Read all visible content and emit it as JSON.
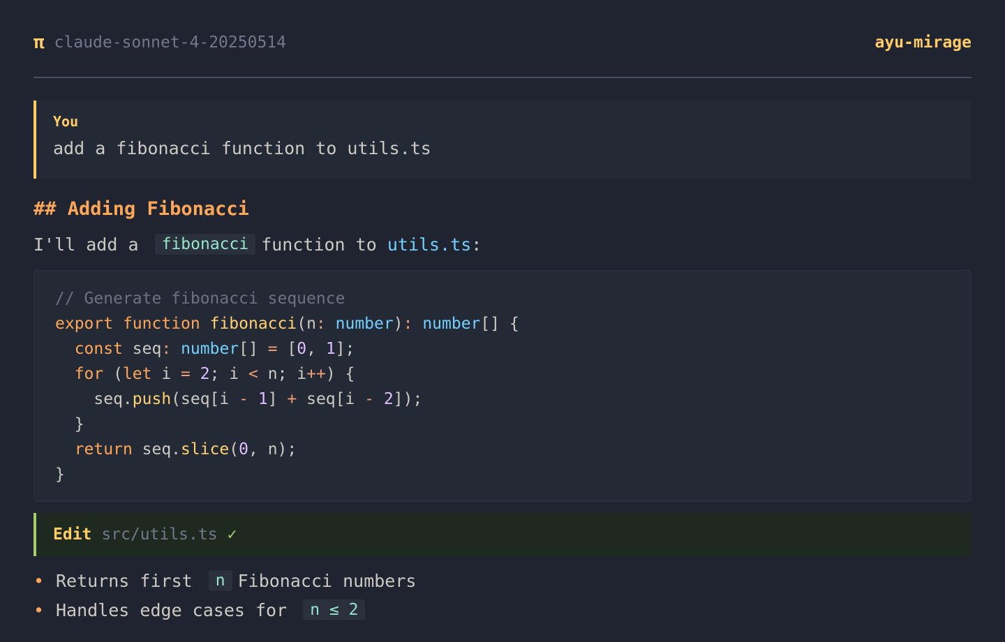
{
  "header": {
    "logo_glyph": "π",
    "model": "claude-sonnet-4-20250514",
    "theme": "ayu-mirage"
  },
  "user_message": {
    "label": "You",
    "text": "add a fibonacci function to utils.ts"
  },
  "response": {
    "heading": "## Adding Fibonacci",
    "intro": {
      "before": "I'll add a",
      "code": "fibonacci",
      "middle": "function to",
      "link": "utils.ts",
      "after": ":"
    },
    "code_lines": [
      [
        {
          "t": "// Generate fibonacci sequence",
          "c": "comment"
        }
      ],
      [
        {
          "t": "export",
          "c": "kw"
        },
        {
          "t": " ",
          "c": "plain"
        },
        {
          "t": "function",
          "c": "kw"
        },
        {
          "t": " ",
          "c": "plain"
        },
        {
          "t": "fibonacci",
          "c": "fn"
        },
        {
          "t": "(n",
          "c": "plain"
        },
        {
          "t": ":",
          "c": "op"
        },
        {
          "t": " ",
          "c": "plain"
        },
        {
          "t": "number",
          "c": "type"
        },
        {
          "t": ")",
          "c": "plain"
        },
        {
          "t": ":",
          "c": "op"
        },
        {
          "t": " ",
          "c": "plain"
        },
        {
          "t": "number",
          "c": "type"
        },
        {
          "t": "[] {",
          "c": "plain"
        }
      ],
      [
        {
          "t": "  ",
          "c": "plain"
        },
        {
          "t": "const",
          "c": "kw"
        },
        {
          "t": " seq",
          "c": "plain"
        },
        {
          "t": ":",
          "c": "op"
        },
        {
          "t": " ",
          "c": "plain"
        },
        {
          "t": "number",
          "c": "type"
        },
        {
          "t": "[] ",
          "c": "plain"
        },
        {
          "t": "=",
          "c": "op"
        },
        {
          "t": " [",
          "c": "plain"
        },
        {
          "t": "0",
          "c": "num"
        },
        {
          "t": ", ",
          "c": "plain"
        },
        {
          "t": "1",
          "c": "num"
        },
        {
          "t": "];",
          "c": "plain"
        }
      ],
      [
        {
          "t": "  ",
          "c": "plain"
        },
        {
          "t": "for",
          "c": "kw"
        },
        {
          "t": " (",
          "c": "plain"
        },
        {
          "t": "let",
          "c": "kw"
        },
        {
          "t": " i ",
          "c": "plain"
        },
        {
          "t": "=",
          "c": "op"
        },
        {
          "t": " ",
          "c": "plain"
        },
        {
          "t": "2",
          "c": "num"
        },
        {
          "t": "; i ",
          "c": "plain"
        },
        {
          "t": "<",
          "c": "op"
        },
        {
          "t": " n; i",
          "c": "plain"
        },
        {
          "t": "++",
          "c": "op"
        },
        {
          "t": ") {",
          "c": "plain"
        }
      ],
      [
        {
          "t": "    seq.",
          "c": "plain"
        },
        {
          "t": "push",
          "c": "fn"
        },
        {
          "t": "(seq[i ",
          "c": "plain"
        },
        {
          "t": "-",
          "c": "op"
        },
        {
          "t": " ",
          "c": "plain"
        },
        {
          "t": "1",
          "c": "num"
        },
        {
          "t": "] ",
          "c": "plain"
        },
        {
          "t": "+",
          "c": "op"
        },
        {
          "t": " seq[i ",
          "c": "plain"
        },
        {
          "t": "-",
          "c": "op"
        },
        {
          "t": " ",
          "c": "plain"
        },
        {
          "t": "2",
          "c": "num"
        },
        {
          "t": "]);",
          "c": "plain"
        }
      ],
      [
        {
          "t": "  }",
          "c": "plain"
        }
      ],
      [
        {
          "t": "  ",
          "c": "plain"
        },
        {
          "t": "return",
          "c": "kw"
        },
        {
          "t": " seq.",
          "c": "plain"
        },
        {
          "t": "slice",
          "c": "fn"
        },
        {
          "t": "(",
          "c": "plain"
        },
        {
          "t": "0",
          "c": "num"
        },
        {
          "t": ", n);",
          "c": "plain"
        }
      ],
      [
        {
          "t": "}",
          "c": "plain"
        }
      ]
    ],
    "tool_call": {
      "name": "Edit",
      "path": "src/utils.ts",
      "status": "✓"
    },
    "bullets": [
      {
        "before": "Returns first",
        "code": "n",
        "after": "Fibonacci numbers"
      },
      {
        "before": "Handles edge cases for",
        "code": "n ≤ 2",
        "after": ""
      }
    ]
  }
}
